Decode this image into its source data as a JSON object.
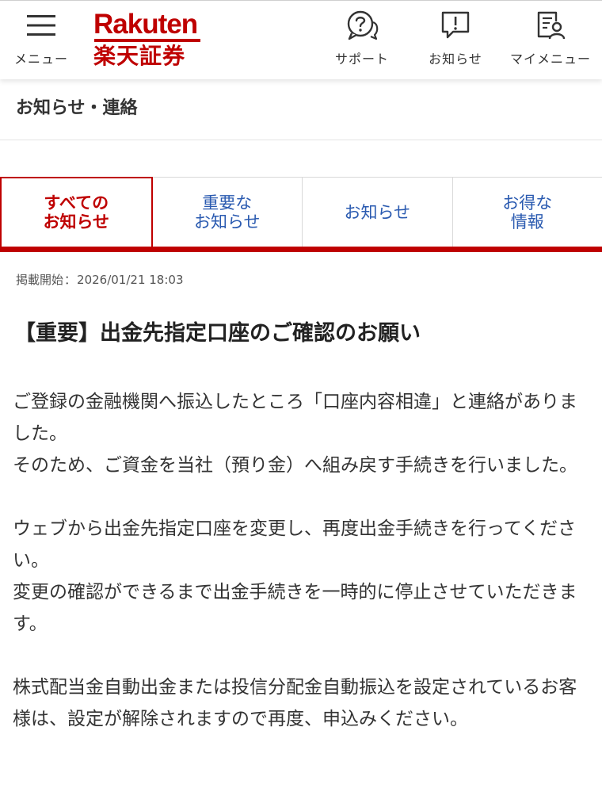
{
  "header": {
    "menu_label": "メニュー",
    "logo_en": "Rakuten",
    "logo_jp": "楽天証券",
    "support_label": "サポート",
    "notices_label": "お知らせ",
    "mymenu_label": "マイメニュー"
  },
  "page": {
    "title": "お知らせ・連絡"
  },
  "tabs": [
    {
      "label": "すべての\nお知らせ",
      "active": true
    },
    {
      "label": "重要な\nお知らせ",
      "active": false
    },
    {
      "label": "お知らせ",
      "active": false
    },
    {
      "label": "お得な\n情報",
      "active": false
    }
  ],
  "notice": {
    "posted_label": "掲載開始",
    "posted_at": "2026/01/21 18:03",
    "headline": "【重要】出金先指定口座のご確認のお願い",
    "paragraphs": [
      [
        "ご登録の金融機関へ振込したところ「口座内容相違」と連絡がありました。",
        "そのため、ご資金を当社（預り金）へ組み戻す手続きを行いました。"
      ],
      [
        "ウェブから出金先指定口座を変更し、再度出金手続きを行ってください。",
        "変更の確認ができるまで出金手続きを一時的に停止させていただきます。"
      ],
      [
        "株式配当金自動出金または投信分配金自動振込を設定されているお客様は、設定が解除されますので再度、申込みください。"
      ]
    ]
  },
  "colors": {
    "brand_red": "#bf0000",
    "tab_blue": "#2a5ab0",
    "text": "#333333"
  }
}
